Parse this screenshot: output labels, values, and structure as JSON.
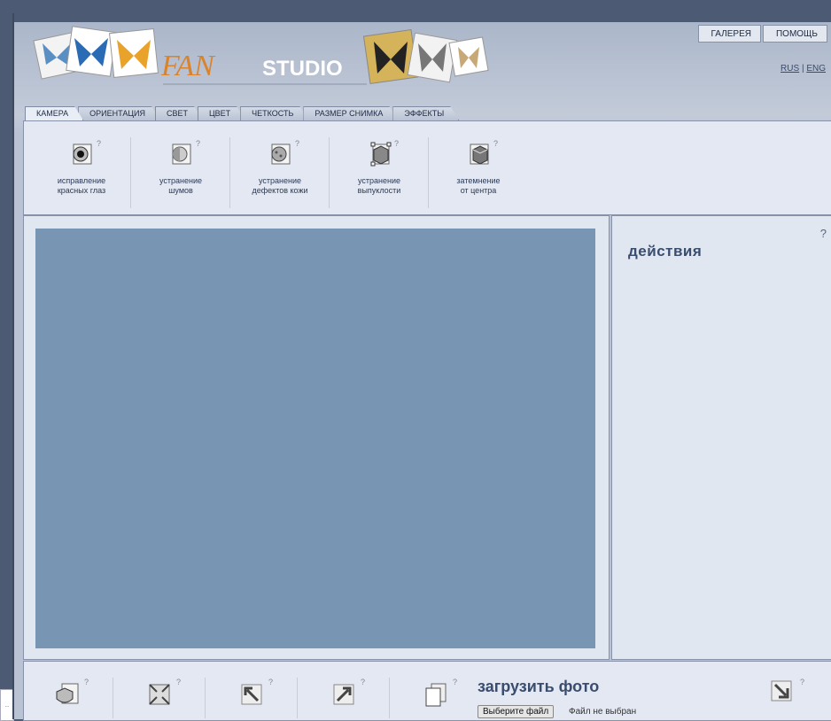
{
  "header": {
    "logo_text_fan": "FAN",
    "logo_text_studio": "STUDIO",
    "top_nav": [
      "ГАЛЕРЕЯ",
      "ПОМОЩЬ"
    ],
    "lang_ru": "RUS",
    "lang_sep": "|",
    "lang_en": "ENG"
  },
  "tabs": [
    "КАМЕРА",
    "ОРИЕНТАЦИЯ",
    "СВЕТ",
    "ЦВЕТ",
    "ЧЕТКОСТЬ",
    "РАЗМЕР СНИМКА",
    "ЭФФЕКТЫ"
  ],
  "active_tab": "КАМЕРА",
  "tools": [
    {
      "label_1": "исправление",
      "label_2": "красных глаз",
      "icon": "red-eye-icon",
      "help": "?"
    },
    {
      "label_1": "устранение",
      "label_2": "шумов",
      "icon": "noise-reduction-icon",
      "help": "?"
    },
    {
      "label_1": "устранение",
      "label_2": "дефектов кожи",
      "icon": "skin-fix-icon",
      "help": "?"
    },
    {
      "label_1": "устранение",
      "label_2": "выпуклости",
      "icon": "bulge-fix-icon",
      "help": "?"
    },
    {
      "label_1": "затемнение",
      "label_2": "от центра",
      "icon": "vignette-icon",
      "help": "?"
    }
  ],
  "actions": {
    "title": "действия",
    "help": "?"
  },
  "bottom": {
    "help": "?",
    "upload_title": "загрузить фото",
    "upload_button": "Выберите файл",
    "upload_status": "Файл не выбран"
  },
  "colors": {
    "canvas": "#7895b3",
    "panel": "#e1e7f1",
    "frame": "#4d5a73"
  }
}
